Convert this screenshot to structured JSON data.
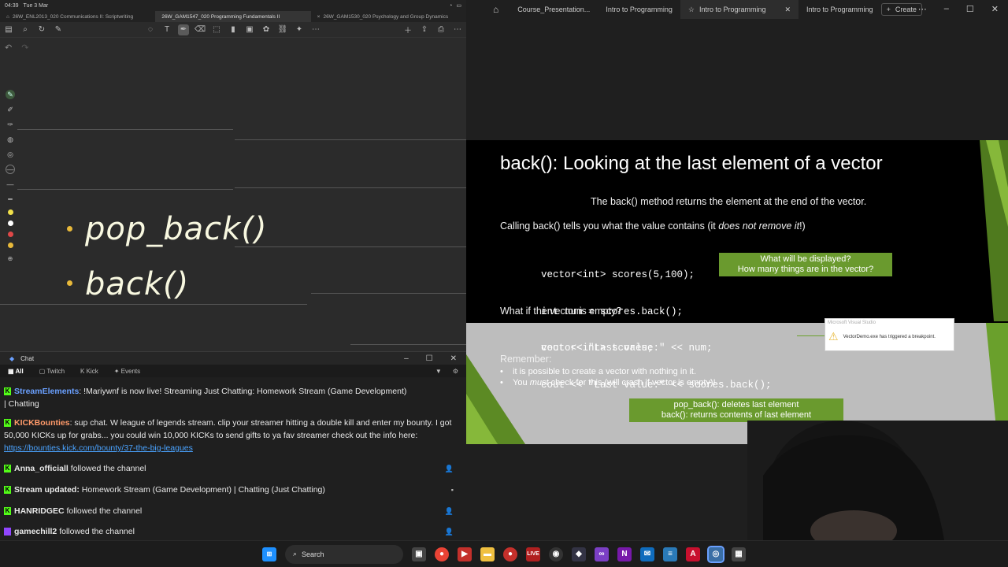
{
  "ios": {
    "time": "04:39",
    "date": "Tue 3 Mar"
  },
  "notes_tabs": [
    {
      "label": "26W_ENL2013_020 Communications II: Scriptwriting"
    },
    {
      "label": "26W_GAM1547_020 Programming Fundamentals II"
    },
    {
      "label": "26W_GAM1530_020 Psychology and Group Dynamics"
    }
  ],
  "notes": {
    "line1": "pop_back()",
    "line2": "back()"
  },
  "chat": {
    "title": "Chat",
    "filters": {
      "all": "All",
      "twitch": "Twitch",
      "kick": "Kick",
      "events": "Events"
    },
    "messages": [
      {
        "user": "StreamElements",
        "text": ": !Mariywnf is now live! Streaming Just Chatting: Homework Stream (Game Development)",
        "cont": "| Chatting"
      },
      {
        "user": "KICKBounties",
        "text": ": sup chat. W league of legends stream. clip your streamer hitting a double kill and enter my bounty. I got 50,000 KICKs up for grabs... you could win 10,000 KICKs to send gifts to ya fav streamer check out the info here: ",
        "link": "https://bounties.kick.com/bounty/37-the-big-leagues"
      },
      {
        "user": "Anna_officiall",
        "text": " followed the channel"
      },
      {
        "user": "Stream updated:",
        "text": " Homework Stream (Game Development) | Chatting (Just Chatting)"
      },
      {
        "user": "HANRIDGEC",
        "text": " followed the channel"
      },
      {
        "user": "gamechill2",
        "text": " followed the channel"
      }
    ]
  },
  "taskbar": {
    "search_label": "Search"
  },
  "pres_tabs": [
    {
      "label": "Course_Presentation..."
    },
    {
      "label": "Intro to Programming"
    },
    {
      "label": "Intro to Programming",
      "active": true
    },
    {
      "label": "Intro to Programming"
    }
  ],
  "create_label": "Create",
  "slide": {
    "title": "back(): Looking at the last element of a vector",
    "subtitle": "The back() method returns the element at the end of the vector.",
    "calling_pre": "Calling back() tells you what the value contains (it ",
    "calling_em": "does not remove it",
    "calling_post": "!)",
    "code1": [
      "vector<int> scores(5,100);",
      "int num = scores.back();",
      "cout << \"Last value:\" << num;"
    ],
    "callout1": [
      "What will be displayed?",
      "How many things are in the vector?"
    ],
    "empty_q": "What if the vector is empty?",
    "code2": [
      "vector<int> scores;",
      "cout << \"Last value:\" << scores.back();"
    ],
    "remember": "Remember:",
    "bullets": [
      {
        "pre": "it is possible to create a vector with nothing in it.",
        "em": "",
        "post": ""
      },
      {
        "pre": "You ",
        "em": "must",
        "post": " check for this (will crash if vector is empty)!"
      }
    ],
    "summary": [
      "pop_back(): deletes last element",
      "back(): returns contents of last element"
    ],
    "vs_title": "Microsoft Visual Studio",
    "vs_msg": "VectorDemo.exe has triggered a breakpoint."
  }
}
